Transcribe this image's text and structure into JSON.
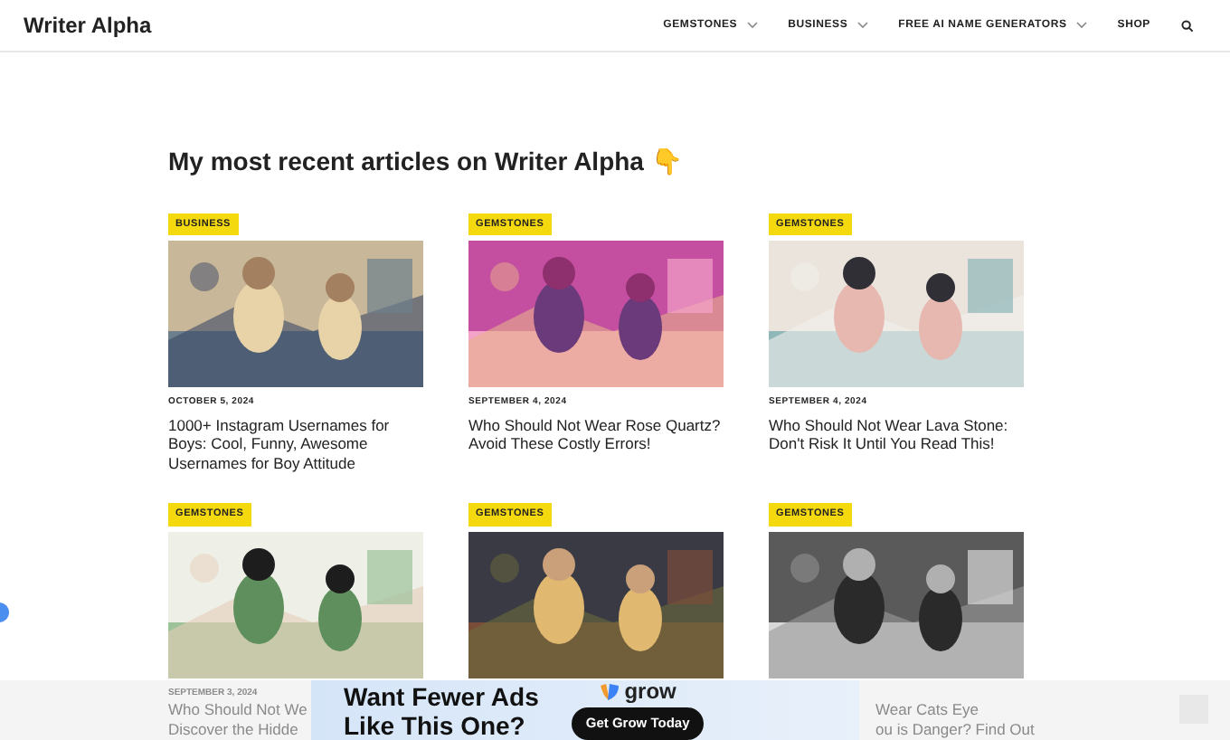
{
  "site_title": "Writer Alpha",
  "nav": [
    {
      "label": "GEMSTONES",
      "has_dropdown": true
    },
    {
      "label": "BUSINESS",
      "has_dropdown": true
    },
    {
      "label": "FREE AI NAME GENERATORS",
      "has_dropdown": true
    },
    {
      "label": "SHOP",
      "has_dropdown": false
    }
  ],
  "heading": "My most recent articles on Writer Alpha 👇",
  "articles": [
    {
      "category": "BUSINESS",
      "date": "OCTOBER 5, 2024",
      "title": "1000+ Instagram Usernames for Boys: Cool, Funny, Awesome Usernames for Boy Attitude"
    },
    {
      "category": "GEMSTONES",
      "date": "SEPTEMBER 4, 2024",
      "title": "Who Should Not Wear Rose Quartz? Avoid These Costly Errors!"
    },
    {
      "category": "GEMSTONES",
      "date": "SEPTEMBER 4, 2024",
      "title": "Who Should Not Wear Lava Stone: Don't Risk It Until You Read This!"
    },
    {
      "category": "GEMSTONES"
    },
    {
      "category": "GEMSTONES"
    },
    {
      "category": "GEMSTONES"
    }
  ],
  "faded_texts": [
    {
      "date": "SEPTEMBER 3, 2024",
      "lines": [
        "Who Should Not We",
        "Discover the Hidde"
      ]
    },
    {
      "lines": [
        "Wear Cats Eye",
        "ou is Danger? Find Out"
      ]
    }
  ],
  "ad": {
    "headline_lines": [
      "Want Fewer Ads",
      "Like This One?"
    ],
    "brand": "grow",
    "cta": "Get Grow Today"
  }
}
